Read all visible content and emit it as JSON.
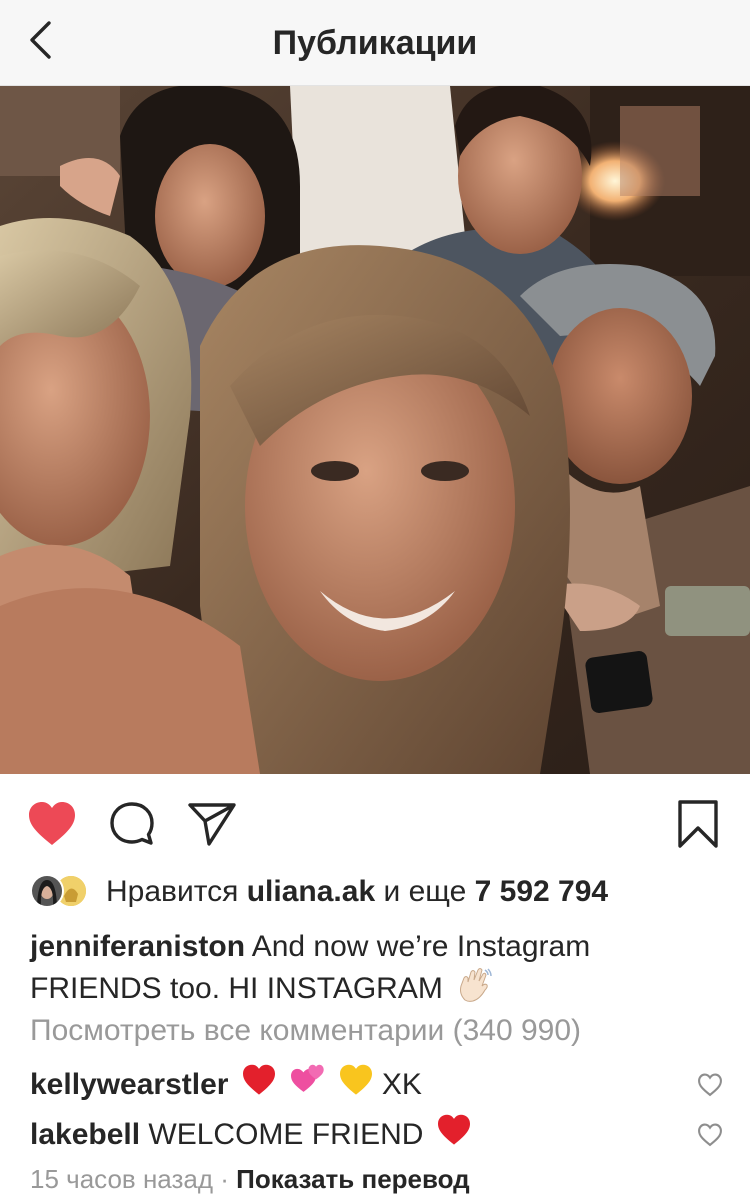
{
  "header": {
    "title": "Публикации",
    "back_icon": "chevron-left-icon"
  },
  "post": {
    "photo_description_icon": "group-selfie-photo",
    "actions": {
      "like_icon": "heart-filled-icon",
      "comment_icon": "comment-bubble-icon",
      "share_icon": "paper-plane-icon",
      "save_icon": "bookmark-icon",
      "like_color": "#ed4956"
    },
    "likes": {
      "prefix": "Нравится",
      "user": "uliana.ak",
      "conjunction": "и еще",
      "count": "7 592 794"
    },
    "caption": {
      "user": "jenniferaniston",
      "text": "And now we’re Instagram FRIENDS too. HI INSTAGRAM",
      "emoji": "waving-hand"
    },
    "view_comments": "Посмотреть все комментарии (340 990)",
    "comments": [
      {
        "user": "kellywearstler",
        "text": "XK",
        "emojis": [
          "red-heart",
          "two-hearts",
          "yellow-heart"
        ]
      },
      {
        "user": "lakebell",
        "text": "WELCOME FRIEND",
        "emojis": [
          "red-heart"
        ]
      }
    ],
    "time_ago": "15 часов назад",
    "separator": "·",
    "translate_label": "Показать перевод"
  }
}
